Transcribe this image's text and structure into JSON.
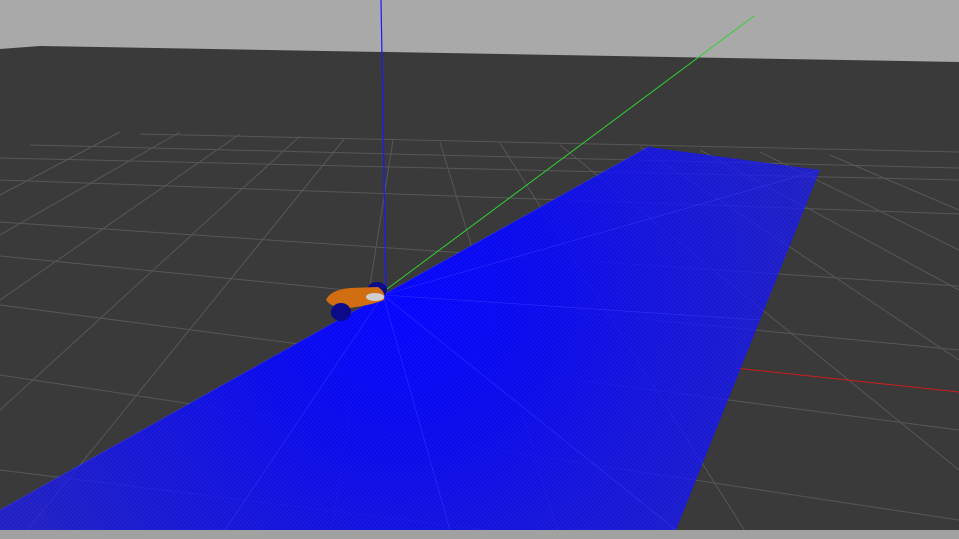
{
  "viewport": {
    "kind": "3d-simulation-view",
    "background_color": "#a9a9a9",
    "ground_color": "#3a3a3a",
    "grid_color": "#575757"
  },
  "axes": {
    "x_color": "#c81e1e",
    "y_color": "#2fd12f",
    "z_color": "#1a1aff"
  },
  "robot": {
    "body_color": "#d26e12",
    "wheel_color": "#0a0a8a",
    "sensor_color": "#cfcfcf"
  },
  "laser_scan": {
    "color": "#0000ff"
  }
}
